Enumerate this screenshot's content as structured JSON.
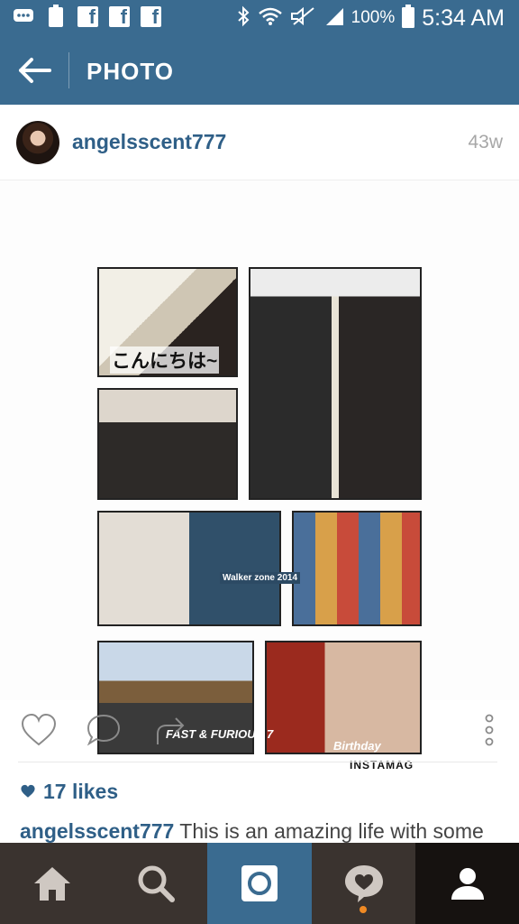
{
  "status_bar": {
    "notification_icons": [
      "message-icon",
      "battery-100-icon",
      "facebook-icon",
      "facebook-icon",
      "facebook-icon"
    ],
    "battery_small_label": "100",
    "facebook_glyph": "f",
    "system_icons": [
      "bluetooth-icon",
      "wifi-icon",
      "mute-icon",
      "signal-icon",
      "battery-icon"
    ],
    "battery_percent": "100%",
    "time": "5:34 AM"
  },
  "app_bar": {
    "title": "PHOTO"
  },
  "post": {
    "username": "angelsscent777",
    "time_ago": "43w",
    "photo_text": {
      "japanese": "こんにちは~",
      "walker": "Walker zone 2014",
      "fast_furious": "FAST & FURIOUS 7",
      "birthday": "Birthday",
      "instamag": "INSTAMAG"
    },
    "likes": "17 likes",
    "caption_user": "angelsscent777",
    "caption_text": " This is an amazing life with some"
  },
  "nav": [
    "home-icon",
    "search-icon",
    "camera-icon",
    "activity-icon",
    "profile-icon"
  ],
  "colors": {
    "header_blue": "#3a6b90",
    "link_blue": "#2f5f87",
    "nav_dark": "#3a332f",
    "nav_active": "#161210",
    "notification_orange": "#f08a24"
  }
}
